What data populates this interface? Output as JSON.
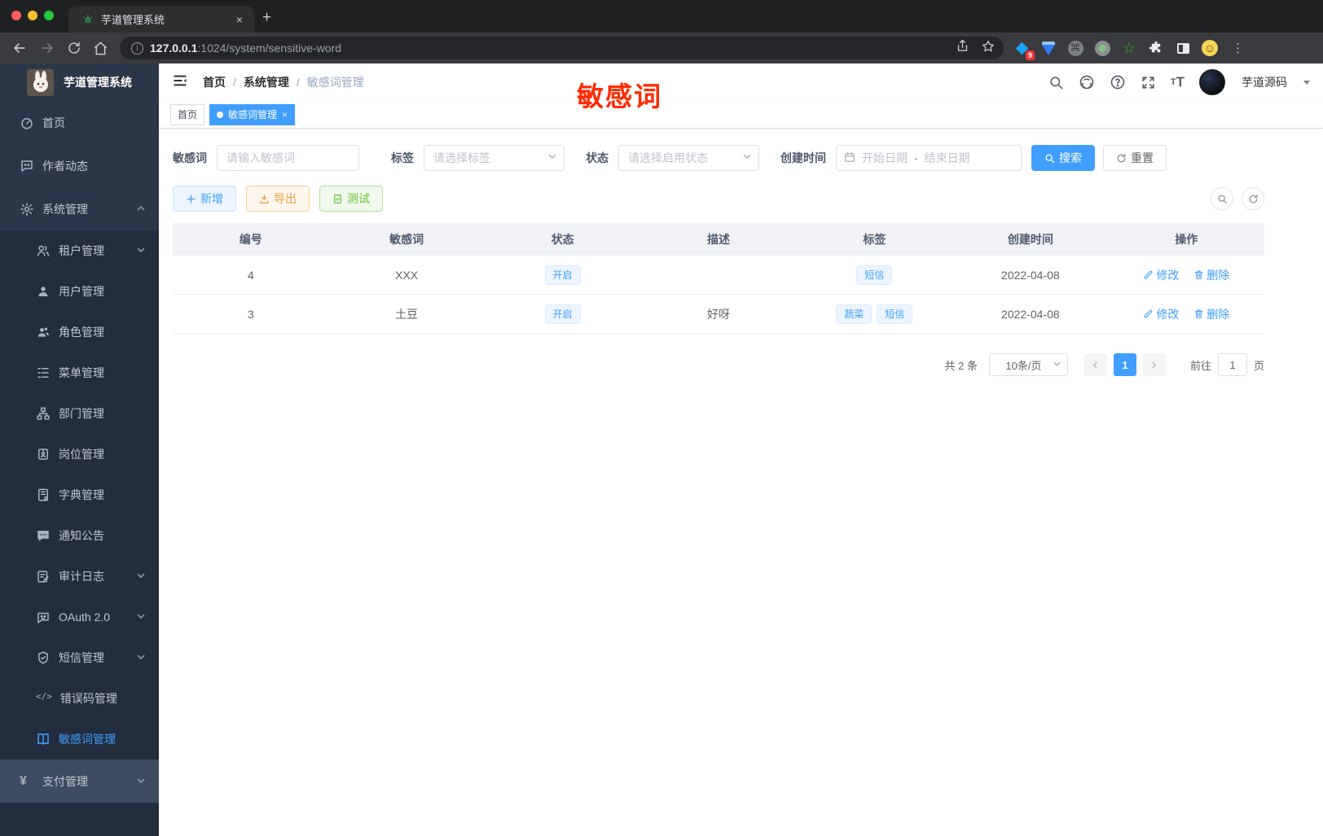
{
  "browser": {
    "tab": {
      "title": "芋道管理系统",
      "close": "×"
    },
    "new_tab": "+",
    "url": {
      "host": "127.0.0.1",
      "rest": ":1024/system/sensitive-word"
    },
    "info_glyph": "i",
    "ext_badge": "9",
    "command_glyph": "⌘",
    "star_glyph": "☆",
    "emoji_glyph": "☺",
    "kebab_glyph": "⋮"
  },
  "header": {
    "annotation": "敏感词",
    "breadcrumb": {
      "items": [
        "首页",
        "系统管理",
        "敏感词管理"
      ],
      "separator": "/"
    },
    "user": {
      "name": "芋道源码"
    }
  },
  "sidebar": {
    "title": "芋道管理系统",
    "items": [
      {
        "label": "首页"
      },
      {
        "label": "作者动态"
      },
      {
        "label": "系统管理"
      },
      {
        "label": "租户管理"
      },
      {
        "label": "用户管理"
      },
      {
        "label": "角色管理"
      },
      {
        "label": "菜单管理"
      },
      {
        "label": "部门管理"
      },
      {
        "label": "岗位管理"
      },
      {
        "label": "字典管理"
      },
      {
        "label": "通知公告"
      },
      {
        "label": "审计日志"
      },
      {
        "label": "OAuth 2.0"
      },
      {
        "label": "短信管理"
      },
      {
        "label": "错误码管理"
      },
      {
        "label": "敏感词管理"
      },
      {
        "label": "支付管理"
      }
    ],
    "code_icon_glyph": "</>",
    "yen_icon_glyph": "¥"
  },
  "tags_view": {
    "tags": [
      {
        "label": "首页"
      },
      {
        "label": "敏感词管理"
      }
    ],
    "close": "×"
  },
  "filters": {
    "keyword_label": "敏感词",
    "keyword_placeholder": "请输入敏感词",
    "tag_label": "标签",
    "tag_placeholder": "请选择标签",
    "status_label": "状态",
    "status_placeholder": "请选择启用状态",
    "date_label": "创建时间",
    "date_start_placeholder": "开始日期",
    "date_separator": "-",
    "date_end_placeholder": "结束日期",
    "search_label": "搜索",
    "reset_label": "重置"
  },
  "toolbar": {
    "add_label": "新增",
    "export_label": "导出",
    "test_label": "测试"
  },
  "table": {
    "columns": [
      "编号",
      "敏感词",
      "状态",
      "描述",
      "标签",
      "创建时间",
      "操作"
    ],
    "rows": [
      {
        "id": "4",
        "word": "XXX",
        "status": "开启",
        "description": "",
        "tags": [
          "短信"
        ],
        "create_time": "2022-04-08",
        "edit": "修改",
        "delete": "删除"
      },
      {
        "id": "3",
        "word": "土豆",
        "status": "开启",
        "description": "好呀",
        "tags": [
          "蔬菜",
          "短信"
        ],
        "create_time": "2022-04-08",
        "edit": "修改",
        "delete": "删除"
      }
    ]
  },
  "pagination": {
    "total": "共 2 条",
    "page_size": "10条/页",
    "current_page": "1",
    "goto_label": "前往",
    "goto_value": "1",
    "page_label": "页"
  },
  "colors": {
    "accent": "#409eff",
    "annotation_red": "#ff2b00",
    "sidebar_bg": "#2b3648",
    "submenu_bg": "#222d3e",
    "success": "#67c23a",
    "warning": "#e6a23c"
  }
}
